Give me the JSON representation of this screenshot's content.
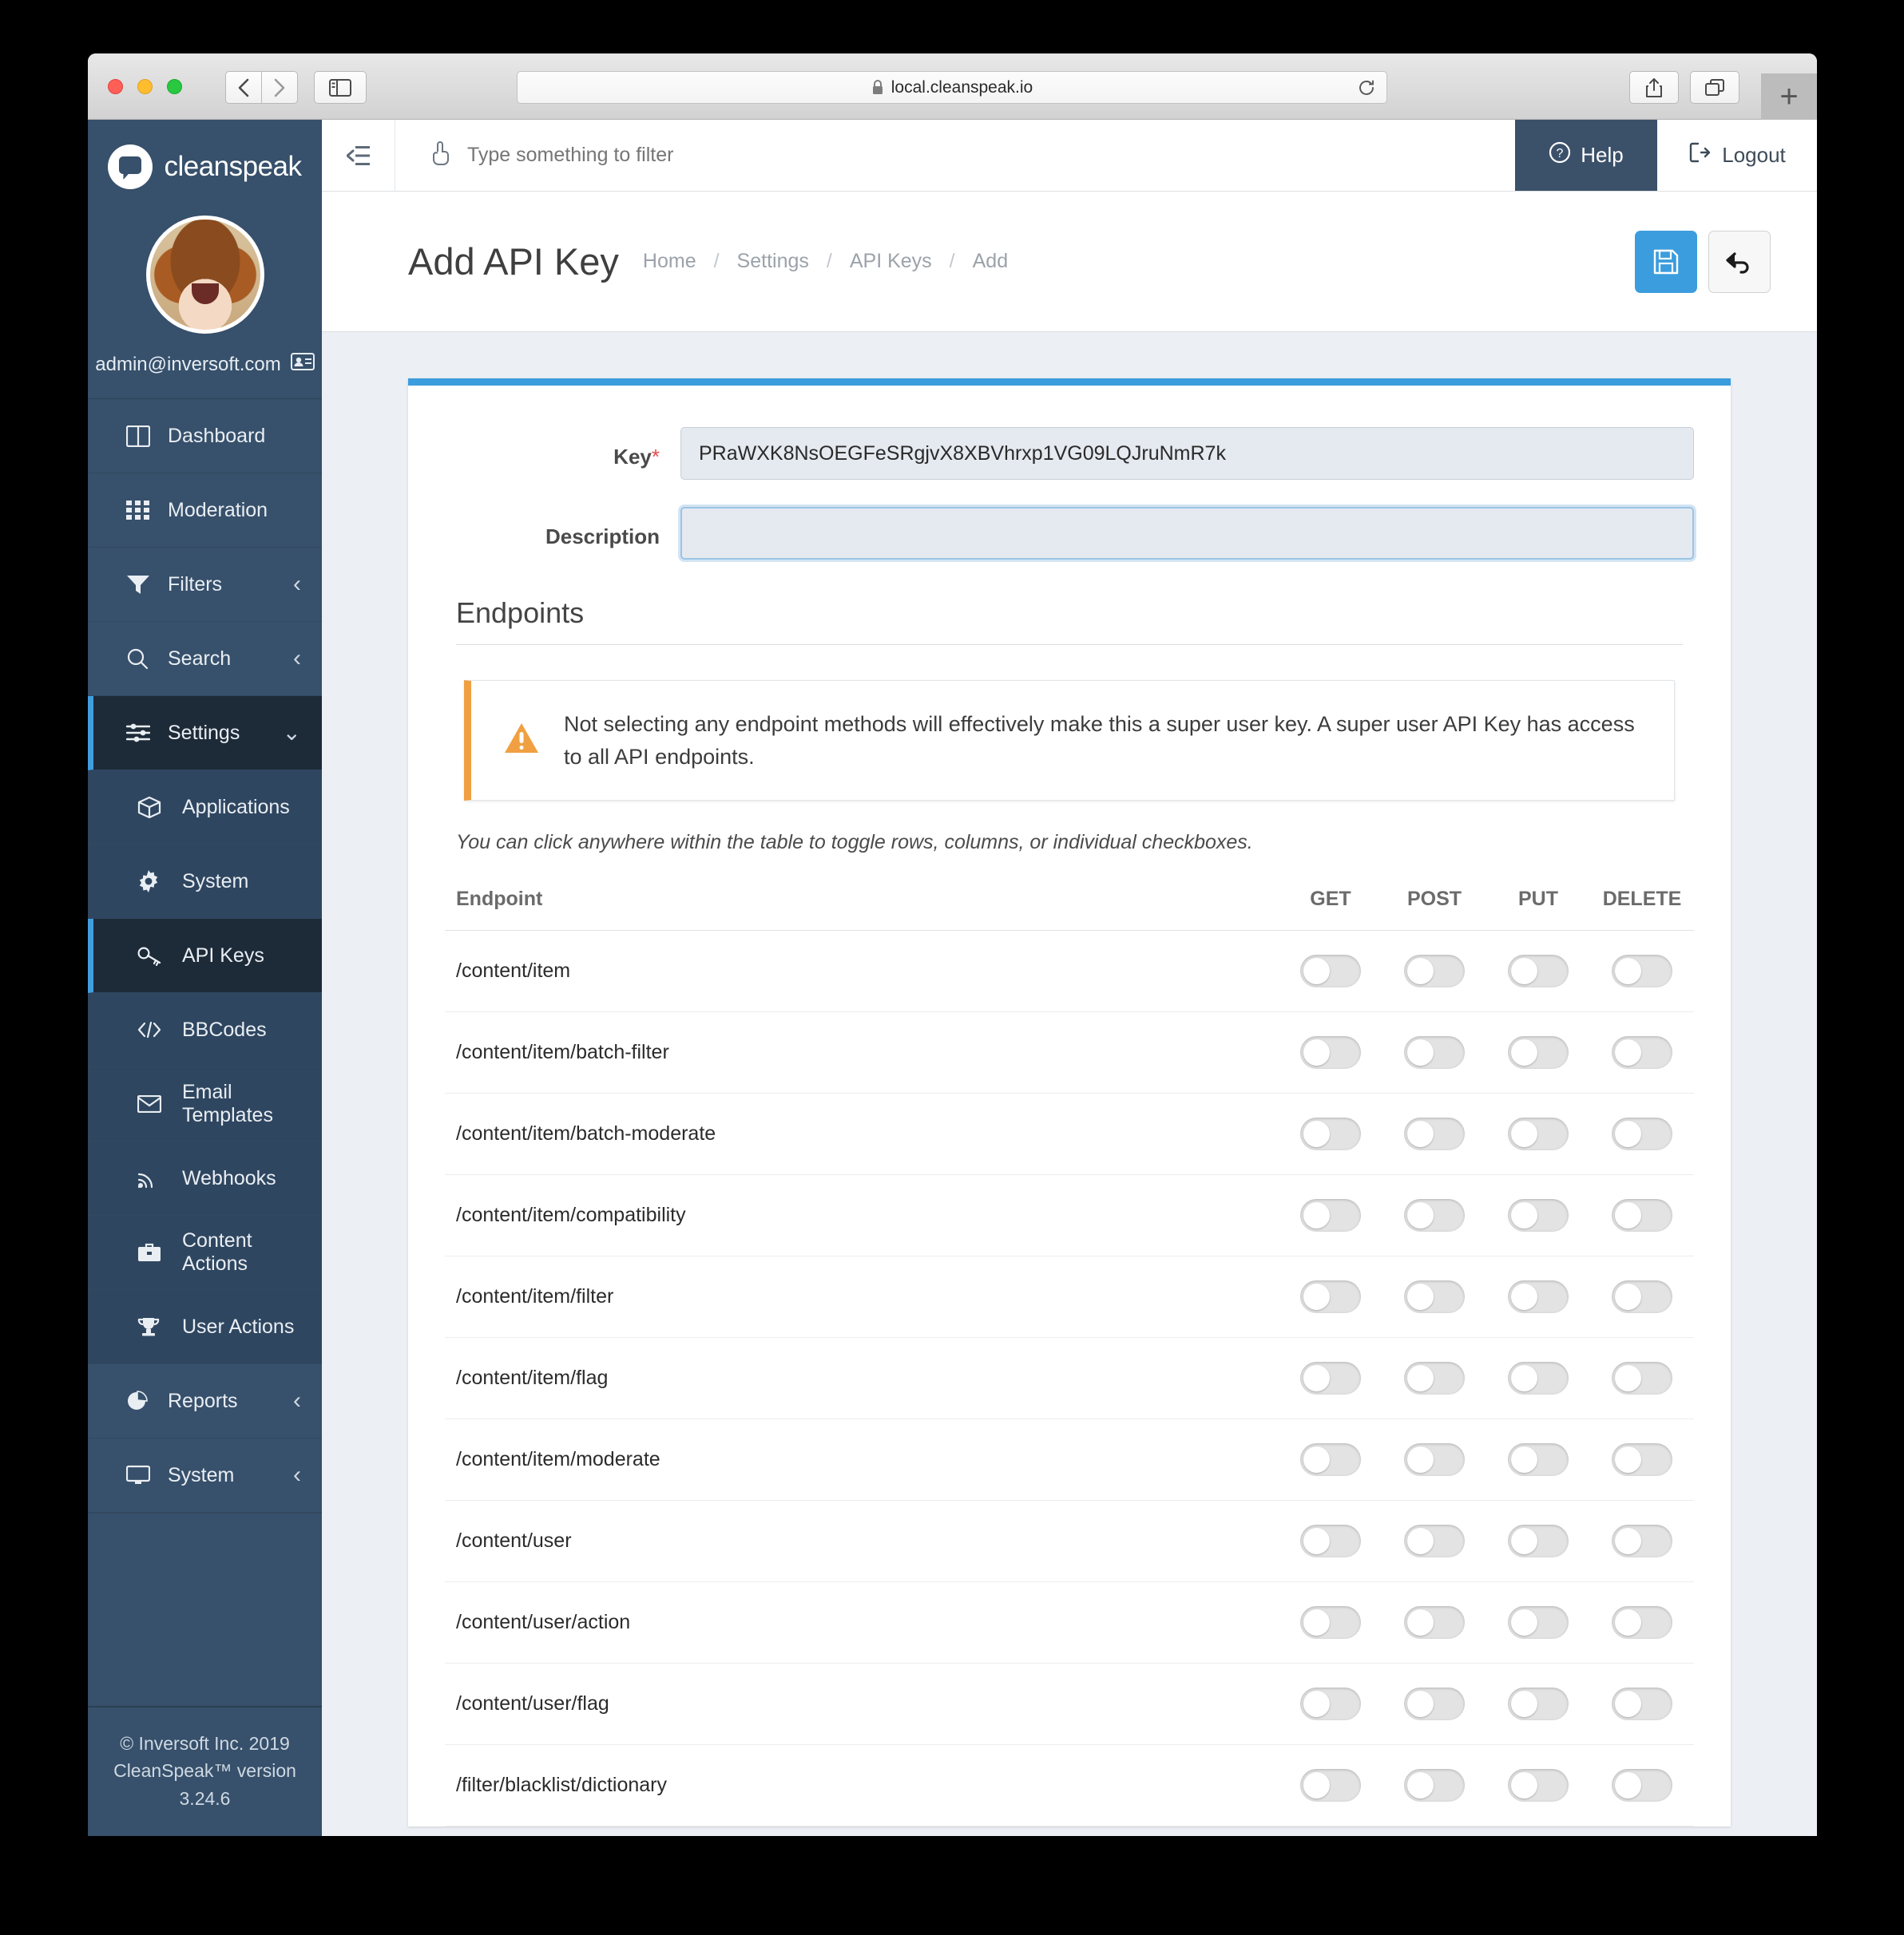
{
  "browser": {
    "url": "local.cleanspeak.io",
    "lock_icon": "lock-icon",
    "back_icon": "chevron-left-icon",
    "forward_icon": "chevron-right-icon",
    "sidebar_icon": "sidebar-panel-icon",
    "reload_icon": "reload-icon",
    "share_icon": "share-icon",
    "tabs_icon": "tabs-overview-icon",
    "new_tab_label": "+"
  },
  "sidebar": {
    "brand": "cleanspeak",
    "user_email": "admin@inversoft.com",
    "user_badge_icon": "id-card-icon",
    "items": [
      {
        "label": "Dashboard",
        "icon": "dashboard-icon",
        "caret": "",
        "level": "top",
        "active": false
      },
      {
        "label": "Moderation",
        "icon": "grid-icon",
        "caret": "",
        "level": "top",
        "active": false
      },
      {
        "label": "Filters",
        "icon": "funnel-icon",
        "caret": "chevron-left-icon",
        "level": "top",
        "active": false
      },
      {
        "label": "Search",
        "icon": "magnifier-icon",
        "caret": "chevron-left-icon",
        "level": "top",
        "active": false
      },
      {
        "label": "Settings",
        "icon": "sliders-icon",
        "caret": "chevron-down-icon",
        "level": "top",
        "active": true
      },
      {
        "label": "Applications",
        "icon": "box-icon",
        "caret": "",
        "level": "sub",
        "active": false
      },
      {
        "label": "System",
        "icon": "gear-icon",
        "caret": "",
        "level": "sub",
        "active": false
      },
      {
        "label": "API Keys",
        "icon": "key-icon",
        "caret": "",
        "level": "sub",
        "active": true
      },
      {
        "label": "BBCodes",
        "icon": "code-icon",
        "caret": "",
        "level": "sub",
        "active": false
      },
      {
        "label": "Email Templates",
        "icon": "envelope-icon",
        "caret": "",
        "level": "sub",
        "active": false
      },
      {
        "label": "Webhooks",
        "icon": "rss-icon",
        "caret": "",
        "level": "sub",
        "active": false
      },
      {
        "label": "Content Actions",
        "icon": "briefcase-icon",
        "caret": "",
        "level": "sub",
        "active": false
      },
      {
        "label": "User Actions",
        "icon": "trophy-icon",
        "caret": "",
        "level": "sub",
        "active": false
      },
      {
        "label": "Reports",
        "icon": "pie-chart-icon",
        "caret": "chevron-left-icon",
        "level": "top",
        "active": false
      },
      {
        "label": "System",
        "icon": "monitor-icon",
        "caret": "chevron-left-icon",
        "level": "top",
        "active": false
      }
    ],
    "footer_line1": "© Inversoft Inc. 2019",
    "footer_line2": "CleanSpeak™ version 3.24.6"
  },
  "topbar": {
    "collapse_icon": "collapse-menu-icon",
    "filter_icon": "pointing-hand-icon",
    "filter_placeholder": "Type something to filter",
    "filter_value": "",
    "help_label": "Help",
    "help_icon": "question-circle-icon",
    "logout_label": "Logout",
    "logout_icon": "logout-icon"
  },
  "page": {
    "title": "Add API Key",
    "breadcrumb": [
      "Home",
      "Settings",
      "API Keys",
      "Add"
    ],
    "save_icon": "floppy-save-icon",
    "cancel_icon": "undo-arrow-icon"
  },
  "form": {
    "key_label": "Key",
    "key_required_mark": "*",
    "key_value": "PRaWXK8NsOEGFeSRgjvX8XBVhrxp1VG09LQJruNmR7k",
    "description_label": "Description",
    "description_value": "",
    "description_placeholder": ""
  },
  "endpoints": {
    "section_title": "Endpoints",
    "warning_icon": "warning-triangle-icon",
    "warning_text": "Not selecting any endpoint methods will effectively make this a super user key. A super user API Key has access to all API endpoints.",
    "hint": "You can click anywhere within the table to toggle rows, columns, or individual checkboxes.",
    "columns": [
      "Endpoint",
      "GET",
      "POST",
      "PUT",
      "DELETE"
    ],
    "rows": [
      {
        "endpoint": "/content/item",
        "GET": false,
        "POST": false,
        "PUT": false,
        "DELETE": false
      },
      {
        "endpoint": "/content/item/batch-filter",
        "GET": false,
        "POST": false,
        "PUT": false,
        "DELETE": false
      },
      {
        "endpoint": "/content/item/batch-moderate",
        "GET": false,
        "POST": false,
        "PUT": false,
        "DELETE": false
      },
      {
        "endpoint": "/content/item/compatibility",
        "GET": false,
        "POST": false,
        "PUT": false,
        "DELETE": false
      },
      {
        "endpoint": "/content/item/filter",
        "GET": false,
        "POST": false,
        "PUT": false,
        "DELETE": false
      },
      {
        "endpoint": "/content/item/flag",
        "GET": false,
        "POST": false,
        "PUT": false,
        "DELETE": false
      },
      {
        "endpoint": "/content/item/moderate",
        "GET": false,
        "POST": false,
        "PUT": false,
        "DELETE": false
      },
      {
        "endpoint": "/content/user",
        "GET": false,
        "POST": false,
        "PUT": false,
        "DELETE": false
      },
      {
        "endpoint": "/content/user/action",
        "GET": false,
        "POST": false,
        "PUT": false,
        "DELETE": false
      },
      {
        "endpoint": "/content/user/flag",
        "GET": false,
        "POST": false,
        "PUT": false,
        "DELETE": false
      },
      {
        "endpoint": "/filter/blacklist/dictionary",
        "GET": false,
        "POST": false,
        "PUT": false,
        "DELETE": false
      }
    ]
  },
  "colors": {
    "accent": "#3b9ddd",
    "sidebar": "#37506b",
    "sidebar_active": "#1d2a38",
    "warning": "#f0a042",
    "required": "#e8494a"
  }
}
